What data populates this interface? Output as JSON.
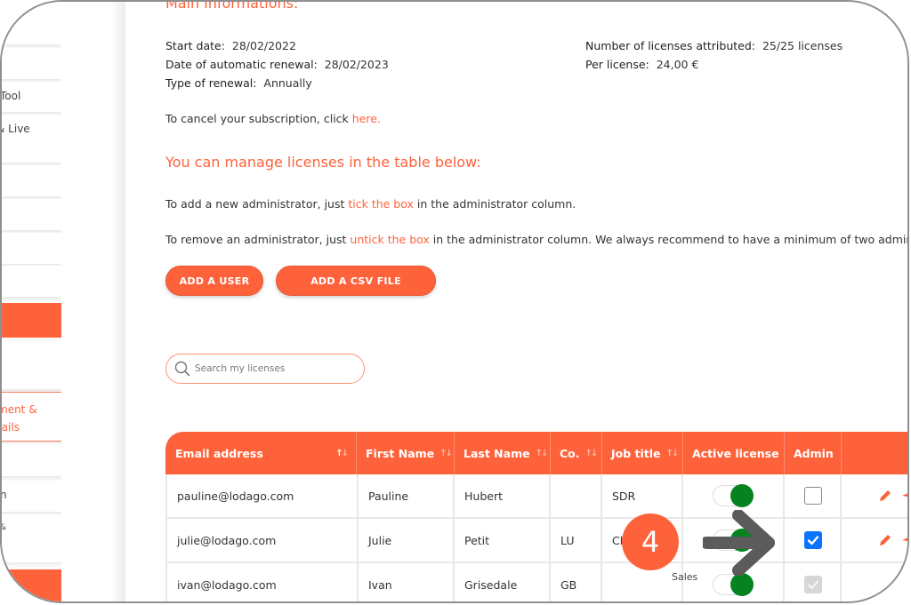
{
  "sidebar": {
    "items": [
      {
        "label": ""
      },
      {
        "label": ""
      },
      {
        "label": "Tool"
      },
      {
        "label": "& Live"
      },
      {
        "label": ""
      },
      {
        "label": ""
      },
      {
        "label": ""
      },
      {
        "label": ""
      },
      {
        "label": ""
      },
      {
        "label": ""
      },
      {
        "label": "n"
      },
      {
        "label": "&"
      },
      {
        "label": ""
      }
    ],
    "highlighted": {
      "line1": "ment &",
      "line2": "tails"
    }
  },
  "main": {
    "section_title": "Main informations:",
    "info_left": [
      {
        "label": "Start date:",
        "value": "28/02/2022"
      },
      {
        "label": "Date of automatic renewal:",
        "value": "28/02/2023"
      },
      {
        "label": "Type of renewal:",
        "value": "Annually"
      }
    ],
    "info_right": [
      {
        "label": "Number of licenses attributed:",
        "value": "25/25 licenses"
      },
      {
        "label": "Per license:",
        "value": "24,00 €"
      }
    ],
    "cancel_text": "To cancel your subscription, click ",
    "cancel_link": "here.",
    "manage_title": "You can manage licenses in the table below:",
    "add_admin": {
      "before": "To add a new administrator, just ",
      "link": "tick the box",
      "after": " in the administrator column."
    },
    "remove_admin": {
      "before": "To remove an administrator, just ",
      "link": "untick the box",
      "after": " in the administrator column. We always recommend to have a minimum of two administra"
    },
    "buttons": {
      "add_user": "ADD A USER",
      "add_csv": "ADD A CSV FILE"
    },
    "search": {
      "placeholder": "Search my licenses",
      "icon": "search-icon"
    }
  },
  "table": {
    "columns": [
      {
        "label": "Email address",
        "sortable": true,
        "sort_active": true
      },
      {
        "label": "First Name",
        "sortable": true
      },
      {
        "label": "Last Name",
        "sortable": true
      },
      {
        "label": "Co.",
        "sortable": true
      },
      {
        "label": "Job title",
        "sortable": true
      },
      {
        "label": "Active license",
        "sortable": false
      },
      {
        "label": "Admin",
        "sortable": false
      },
      {
        "label": "",
        "sortable": false
      }
    ],
    "rows": [
      {
        "email": "pauline@lodago.com",
        "first": "Pauline",
        "last": "Hubert",
        "co": "",
        "job": "SDR",
        "active": true,
        "admin": "unchecked",
        "actions": [
          "pencil-icon",
          "send-icon"
        ]
      },
      {
        "email": "julie@lodago.com",
        "first": "Julie",
        "last": "Petit",
        "co": "LU",
        "job": "Cl",
        "active": true,
        "admin": "checked",
        "actions": [
          "pencil-icon",
          "send-icon"
        ]
      },
      {
        "email": "ivan@lodago.com",
        "first": "Ivan",
        "last": "Grisedale",
        "co": "GB",
        "job": "",
        "active": true,
        "admin": "checked-disabled",
        "actions": []
      }
    ]
  },
  "annotation": {
    "step_number": "4",
    "floating_label": "Sales"
  },
  "colors": {
    "accent": "#fe623b",
    "toggle_on": "#04831e",
    "checkbox_on": "#0a74ff",
    "arrow": "#5b5b5b"
  }
}
